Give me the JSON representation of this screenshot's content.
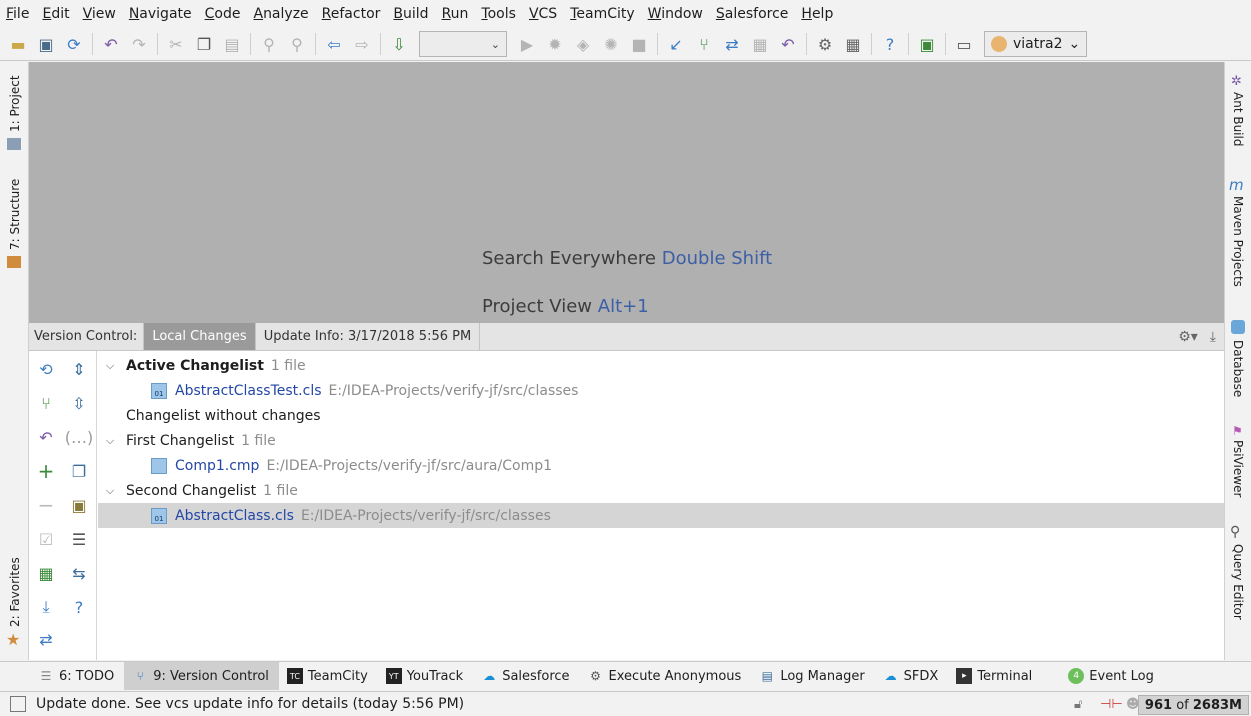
{
  "menu": [
    "File",
    "Edit",
    "View",
    "Navigate",
    "Code",
    "Analyze",
    "Refactor",
    "Build",
    "Run",
    "Tools",
    "VCS",
    "TeamCity",
    "Window",
    "Salesforce",
    "Help"
  ],
  "toolbar": {
    "user": "viatra2",
    "config_value": ""
  },
  "left_stripe": {
    "project": "1: Project",
    "structure": "7: Structure",
    "favorites": "2: Favorites"
  },
  "right_stripe": {
    "ant": "Ant Build",
    "maven": "Maven Projects",
    "database": "Database",
    "psi": "PsiViewer",
    "query": "Query Editor"
  },
  "editor_hints": [
    {
      "text": "Search Everywhere",
      "key": "Double Shift"
    },
    {
      "text": "Project View",
      "key": "Alt+1"
    }
  ],
  "vc": {
    "label": "Version Control:",
    "tabs": [
      "Local Changes",
      "Update Info: 3/17/2018 5:56 PM"
    ],
    "changelists": [
      {
        "name": "Active Changelist",
        "count": "1 file",
        "bold": true,
        "files": [
          {
            "name": "AbstractClassTest.cls",
            "path": "E:/IDEA-Projects/verify-jf/src/classes"
          }
        ]
      },
      {
        "name": "Changelist without changes",
        "count": "",
        "files": []
      },
      {
        "name": "First Changelist",
        "count": "1 file",
        "files": [
          {
            "name": "Comp1.cmp",
            "path": "E:/IDEA-Projects/verify-jf/src/aura/Comp1"
          }
        ]
      },
      {
        "name": "Second Changelist",
        "count": "1 file",
        "files": [
          {
            "name": "AbstractClass.cls",
            "path": "E:/IDEA-Projects/verify-jf/src/classes"
          }
        ]
      }
    ]
  },
  "bottom_tabs": [
    "6: TODO",
    "9: Version Control",
    "TeamCity",
    "YouTrack",
    "Salesforce",
    "Execute Anonymous",
    "Log Manager",
    "SFDX",
    "Terminal",
    "Event Log"
  ],
  "event_log_count": "4",
  "status": {
    "message": "Update done. See vcs update info for details (today 5:56 PM)",
    "mem_used": "961",
    "mem_of": "of",
    "mem_total": "2683M"
  },
  "colors": {
    "link": "#2347a5",
    "accent": "#3c5fa6",
    "selection": "#d5d5d5"
  }
}
